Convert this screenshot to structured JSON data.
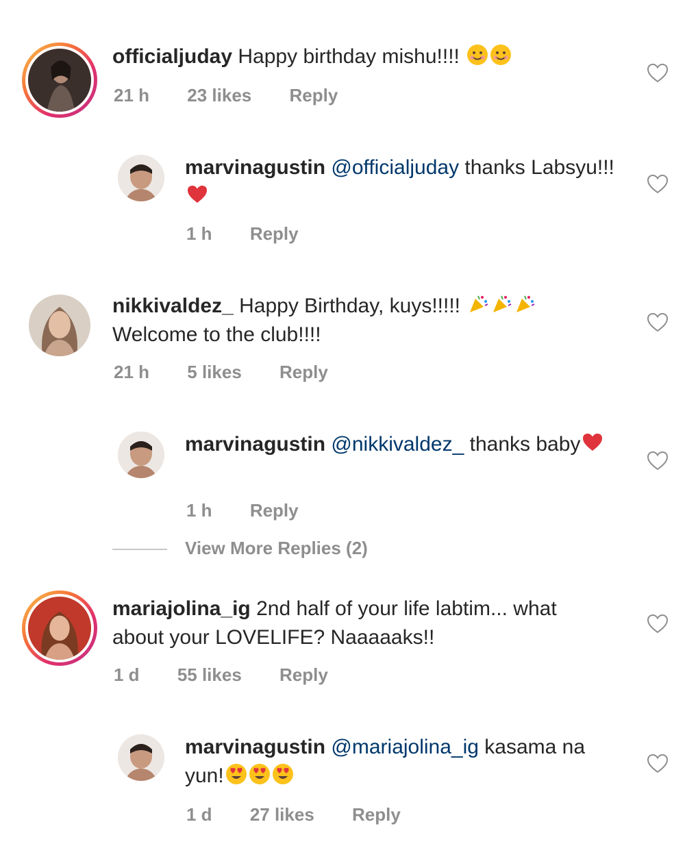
{
  "comments": [
    {
      "username": "officialjuday",
      "text": "Happy birthday mishu!!!!",
      "time": "21 h",
      "likes": "23 likes",
      "reply": "Reply",
      "emojis": [
        "smile",
        "smile"
      ]
    },
    {
      "username": "marvinagustin",
      "mention": "@officialjuday",
      "text": " thanks Labsyu!!!",
      "time": "1 h",
      "reply": "Reply",
      "emojis": [
        "heart"
      ]
    },
    {
      "username": "nikkivaldez_",
      "text": "Happy Birthday, kuys!!!!!",
      "text2": "Welcome to the club!!!!",
      "time": "21 h",
      "likes": "5 likes",
      "reply": "Reply",
      "emojis": [
        "party",
        "party",
        "party"
      ]
    },
    {
      "username": "marvinagustin",
      "mention": "@nikkivaldez_",
      "text": " thanks baby",
      "time": "1 h",
      "reply": "Reply",
      "emojis": [
        "heart"
      ]
    },
    {
      "username": "mariajolina_ig",
      "text": "2nd half of your life labtim... what about your LOVELIFE? Naaaaaks!!",
      "time": "1 d",
      "likes": "55 likes",
      "reply": "Reply"
    },
    {
      "username": "marvinagustin",
      "mention": "@mariajolina_ig",
      "text": " kasama na yun!",
      "time": "1 d",
      "likes": "27 likes",
      "reply": "Reply",
      "emojis": [
        "heart-eyes",
        "heart-eyes",
        "heart-eyes"
      ]
    }
  ],
  "view_more": "View More Replies (2)",
  "colors": {
    "username": "#262626",
    "mention": "#00376b",
    "meta": "#8e8e8e",
    "heart_red": "#ed4956"
  }
}
